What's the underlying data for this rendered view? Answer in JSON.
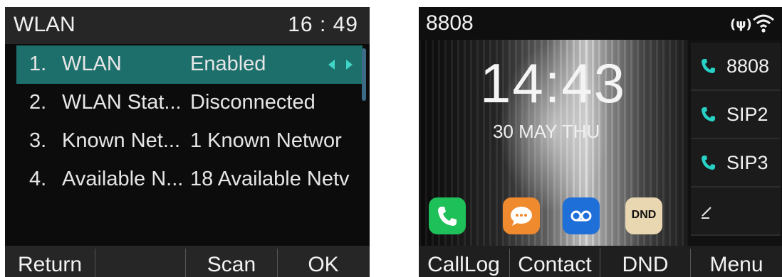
{
  "left_screen": {
    "header": {
      "title": "WLAN",
      "time": "16 : 49"
    },
    "items": [
      {
        "num": "1.",
        "name": "WLAN",
        "value": "Enabled"
      },
      {
        "num": "2.",
        "name": "WLAN Stat...",
        "value": "Disconnected"
      },
      {
        "num": "3.",
        "name": "Known Net...",
        "value": "1 Known Networ"
      },
      {
        "num": "4.",
        "name": "Available N...",
        "value": "18 Available Netv"
      }
    ],
    "softkeys": [
      "Return",
      "",
      "Scan",
      "OK"
    ]
  },
  "right_screen": {
    "header": {
      "extension": "8808",
      "signal_glyph": "(ψ)"
    },
    "clock": "14:43",
    "date": "30 MAY THU",
    "apps": [
      {
        "name": "phone-app-icon",
        "color": "#1ec05a"
      },
      {
        "name": "message-app-icon",
        "color": "#f08a2e"
      },
      {
        "name": "voicemail-app-icon",
        "color": "#1f6fd8"
      },
      {
        "name": "dnd-app-icon",
        "label": "DND",
        "color": "#e8d7b0"
      }
    ],
    "lines": [
      "8808",
      "SIP2",
      "SIP3"
    ],
    "softkeys": [
      "CallLog",
      "Contact",
      "DND",
      "Menu"
    ]
  },
  "colors": {
    "selected_row": "#1d6f6b",
    "arrow_accent": "#3fd6c8",
    "line_icon": "#28d1c6"
  }
}
